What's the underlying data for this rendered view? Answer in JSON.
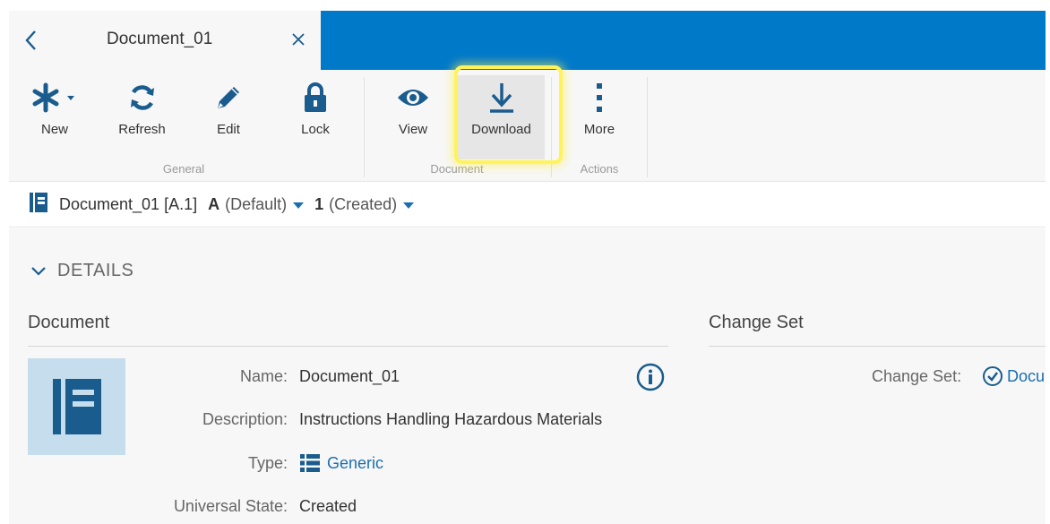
{
  "tab": {
    "title": "Document_01"
  },
  "toolbar": {
    "buttons": [
      {
        "label": "New",
        "icon": "asterisk-icon"
      },
      {
        "label": "Refresh",
        "icon": "refresh-icon"
      },
      {
        "label": "Edit",
        "icon": "pencil-icon"
      },
      {
        "label": "Lock",
        "icon": "lock-icon"
      },
      {
        "label": "View",
        "icon": "eye-icon"
      },
      {
        "label": "Download",
        "icon": "download-icon"
      },
      {
        "label": "More",
        "icon": "more-vertical-icon"
      }
    ],
    "groups": [
      "General",
      "Document",
      "Actions"
    ]
  },
  "breadcrumb": {
    "doc": "Document_01 [A.1]",
    "revision_letter": "A",
    "revision_label": "(Default)",
    "iteration_number": "1",
    "iteration_label": "(Created)"
  },
  "details": {
    "heading": "DETAILS",
    "document_section": "Document",
    "changeset_section": "Change Set",
    "fields": {
      "name_label": "Name:",
      "name_value": "Document_01",
      "description_label": "Description:",
      "description_value": "Instructions Handling Hazardous Materials",
      "type_label": "Type:",
      "type_value": "Generic",
      "state_label": "Universal State:",
      "state_value": "Created"
    },
    "changeset": {
      "label": "Change Set:",
      "value": "Docu"
    }
  },
  "colors": {
    "accent": "#0079c9",
    "icon": "#1b5c8e",
    "link": "#1a6fb0",
    "highlight": "#fff35b"
  }
}
